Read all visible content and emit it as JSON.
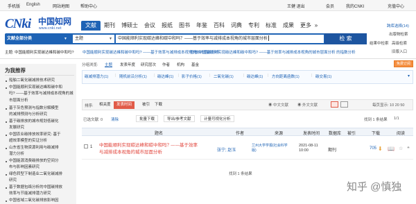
{
  "topbar": {
    "left": [
      "手机版",
      "English",
      "网站地图",
      "帮助中心"
    ],
    "right": [
      "王健  退出",
      "会员",
      "我的CNKI",
      "充值中心"
    ]
  },
  "logo": {
    "mark": "CNki",
    "cn": "中国知网",
    "url": "www.cnki.net"
  },
  "nav": {
    "tabs": [
      {
        "label": "文献",
        "active": true
      },
      {
        "label": "期刊"
      },
      {
        "label": "博硕士"
      },
      {
        "label": "会议"
      },
      {
        "label": "报纸"
      },
      {
        "label": "图书"
      },
      {
        "label": "年鉴"
      },
      {
        "label": "百科"
      },
      {
        "label": "词典"
      },
      {
        "label": "专利"
      },
      {
        "label": "标准"
      },
      {
        "label": "成果"
      },
      {
        "label": "更多"
      }
    ],
    "more_arrow": "»",
    "right": {
      "cross_lang": "跨库选择(14)",
      "publish_search": "出版物检索",
      "advanced": "高级检索",
      "expert": "结果中检索",
      "old": "旧版入口"
    }
  },
  "search": {
    "scope": "文献全部分类",
    "field": "主题",
    "query": "中国能顺利实现碳达峰和碳中和吗？——基于效率与减排成本视角的城市层面分析",
    "button": "检 索",
    "links": {
      "history": "结果中检索",
      "classic": "高级检索"
    }
  },
  "suggest": {
    "s1": "主题: 中国能顺利实现碳达峰和碳中和吗?",
    "s2": "中国能顺利实现碳达峰和碳中和吗? ——基于效率与减排成本视角的城市层面分析",
    "s3": "查看 中国能顺利实现碳达峰和碳中和吗? ——基于效率与减排成本视角的城市层面分析 的指数分析"
  },
  "sidebar": {
    "title": "为我推荐",
    "items": [
      {
        "text": "船舶二氧化碳减排技术研究",
        "cont": ""
      },
      {
        "text": "中国能顺利实现碳达峰和碳中和",
        "cont": "吗? ——基于效率与减排成本视角的城市层面分析"
      },
      {
        "text": "基于灰色预测与指数分解模型",
        "cont": "的减排预测与分析研究"
      },
      {
        "text": "基于碳排放的城市规划低碳化",
        "cont": "发展研究"
      },
      {
        "text": "中国农业碳排放效率研究: 基于",
        "cont": "超效率模型的实证分析"
      },
      {
        "text": "山东省生物资源利用与碳减排",
        "cont": "潜力分析"
      },
      {
        "text": "中国能源消费碳排放的空间分",
        "cont": "布与影响因素研究"
      },
      {
        "text": "绿色转型下制造业二氧化碳减排",
        "cont": "研究"
      },
      {
        "text": "基于数据包络分析的中国碳排放",
        "cont": "效率与节能减排潜力研究"
      },
      {
        "text": "中国省域二氧化碳排放影响因",
        "cont": "素研究"
      }
    ]
  },
  "groups": {
    "label": "分组浏览:",
    "items": [
      "主题",
      "发表年度",
      "研究层次",
      "作者",
      "机构",
      "基金"
    ],
    "free": "免费订阅"
  },
  "filters": [
    "碳减排潜力(1)",
    "随机前沿分析(1)",
    "碳达峰(1)",
    "影子价格(1)",
    "二氧化碳(1)",
    "碳达峰(1)",
    "方向距离函数(1)",
    "碳交易(1)"
  ],
  "sort": {
    "label": "排序:",
    "buttons": [
      "相关度",
      "发表时间",
      "被引",
      "下载"
    ],
    "lang": [
      "中文文献",
      "外文文献"
    ],
    "per_page": "每页显示: 10  20  50"
  },
  "actions": {
    "selected": "已选文献: 0",
    "clear": "清除",
    "batch": "批量下载",
    "export": "导出/参考文献",
    "analysis": "计量可视化分析",
    "found": "找到 1 条结果",
    "page": "1/1"
  },
  "table": {
    "headers": [
      "题名",
      "作者",
      "来源",
      "发表时间",
      "数据库",
      "被引",
      "下载",
      "阅读"
    ],
    "rows": [
      {
        "index": "1",
        "title": "中国能顺利实现碳达峰和碳中和吗? ——基于效率与减排成本视角的城市层面分析",
        "author": "张宁; 赵玉",
        "source": "兰州大学学报(社会科学版)",
        "date": "2021-08-11",
        "time": "10:00",
        "db": "期刊",
        "cited": "",
        "downloads": "705"
      }
    ]
  },
  "footer": {
    "found": "找到 1 条结果"
  },
  "watermark": "知乎 @慎独",
  "colors": {
    "brand": "#1e63b5",
    "accent": "#e15b48",
    "title": "#e1433a"
  }
}
